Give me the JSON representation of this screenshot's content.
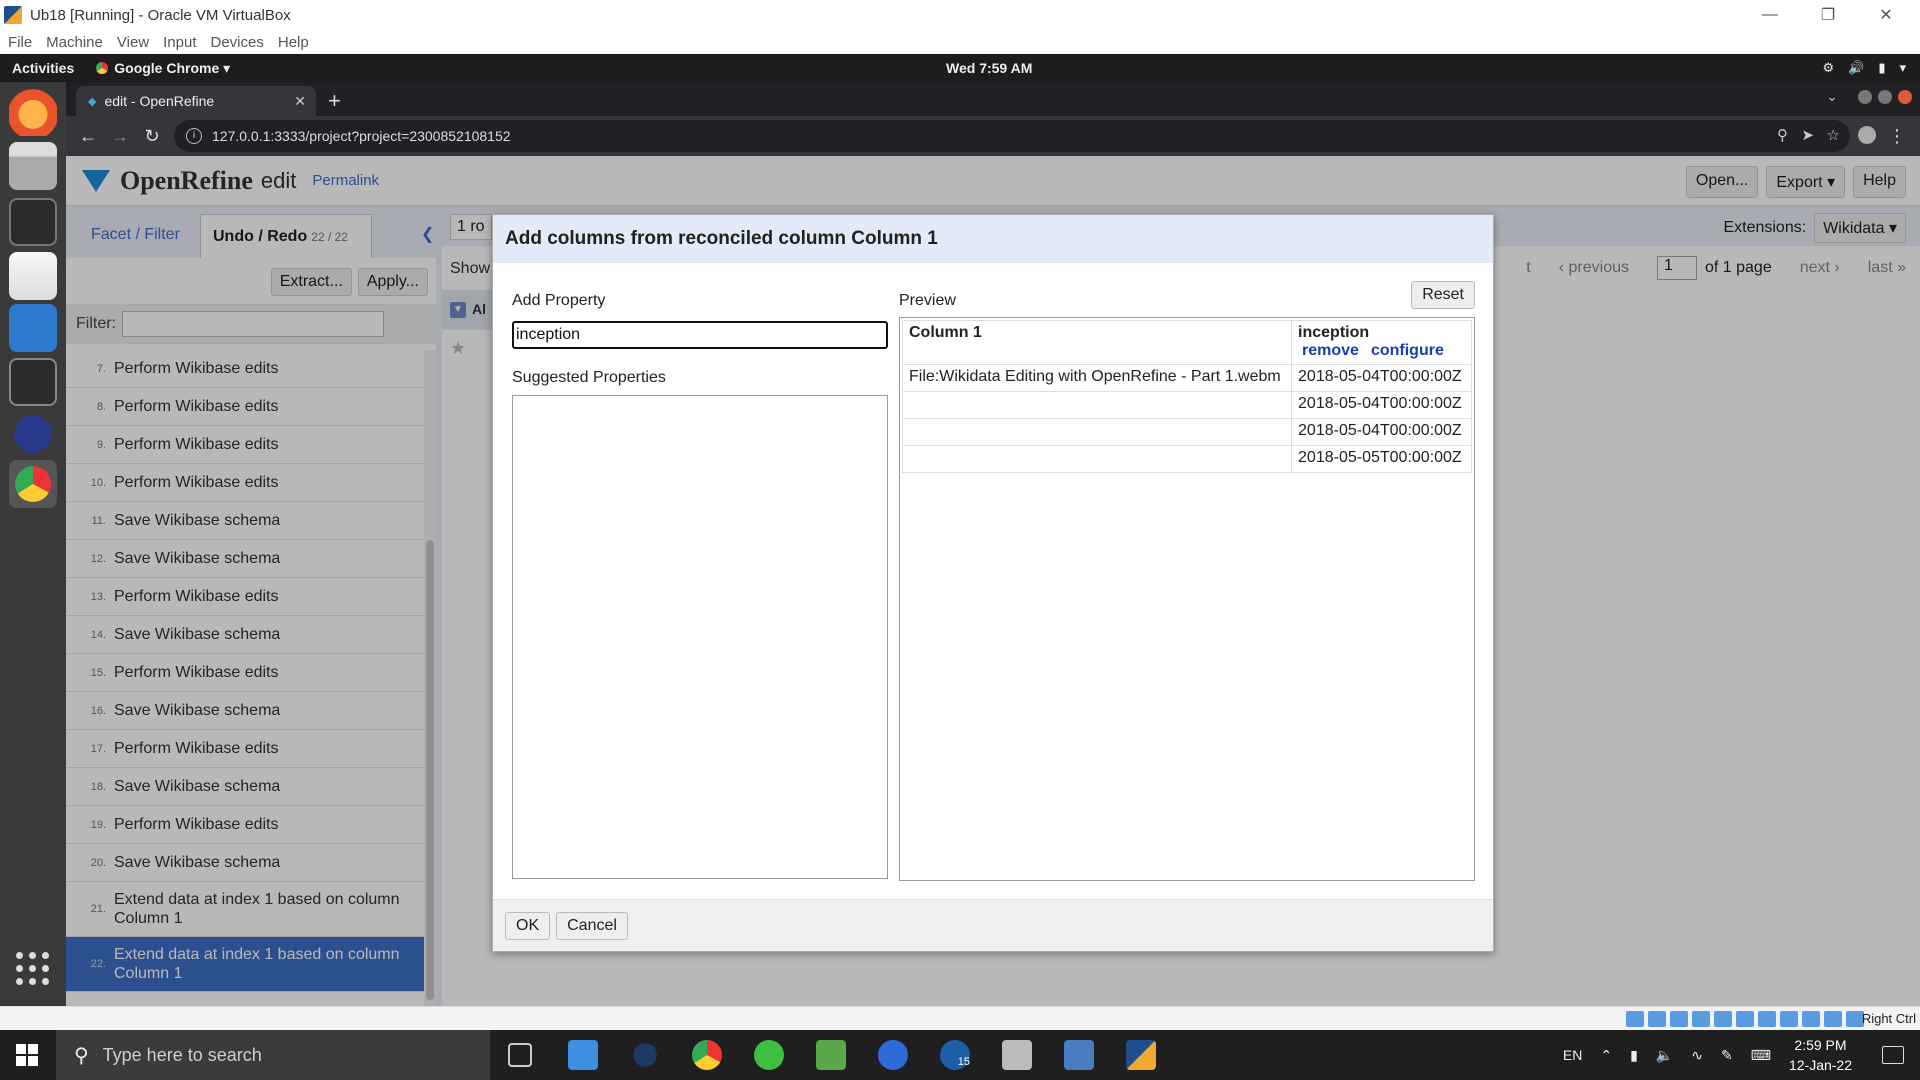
{
  "vbox": {
    "title": "Ub18 [Running] - Oracle VM VirtualBox",
    "menu": [
      "File",
      "Machine",
      "View",
      "Input",
      "Devices",
      "Help"
    ],
    "status_right": "Right Ctrl"
  },
  "gnome": {
    "activities": "Activities",
    "app": "Google Chrome ▾",
    "clock": "Wed  7:59 AM"
  },
  "chrome": {
    "tab_title": "edit - OpenRefine",
    "url": "127.0.0.1:3333/project?project=2300852108152"
  },
  "openrefine": {
    "brand": "OpenRefine",
    "mode": "edit",
    "permalink": "Permalink",
    "header_buttons": [
      "Open...",
      "Export ▾",
      "Help"
    ],
    "left_tabs": {
      "facet": "Facet / Filter",
      "undo": "Undo / Redo",
      "undo_count": "22 / 22"
    },
    "left_actions": [
      "Extract...",
      "Apply..."
    ],
    "filter_label": "Filter:",
    "history": [
      {
        "n": "7.",
        "t": "Perform Wikibase edits"
      },
      {
        "n": "8.",
        "t": "Perform Wikibase edits"
      },
      {
        "n": "9.",
        "t": "Perform Wikibase edits"
      },
      {
        "n": "10.",
        "t": "Perform Wikibase edits"
      },
      {
        "n": "11.",
        "t": "Save Wikibase schema"
      },
      {
        "n": "12.",
        "t": "Save Wikibase schema"
      },
      {
        "n": "13.",
        "t": "Perform Wikibase edits"
      },
      {
        "n": "14.",
        "t": "Save Wikibase schema"
      },
      {
        "n": "15.",
        "t": "Perform Wikibase edits"
      },
      {
        "n": "16.",
        "t": "Save Wikibase schema"
      },
      {
        "n": "17.",
        "t": "Perform Wikibase edits"
      },
      {
        "n": "18.",
        "t": "Save Wikibase schema"
      },
      {
        "n": "19.",
        "t": "Perform Wikibase edits"
      },
      {
        "n": "20.",
        "t": "Save Wikibase schema"
      },
      {
        "n": "21.",
        "t": "Extend data at index 1 based on column Column 1"
      },
      {
        "n": "22.",
        "t": "Extend data at index 1 based on column Column 1"
      }
    ],
    "rows_partial": "1 ro",
    "show_partial": "Show",
    "all_partial": "Al",
    "extensions_label": "Extensions:",
    "extensions_btn": "Wikidata ▾",
    "pager": {
      "first_partial": "t",
      "previous": "‹ previous",
      "page_value": "1",
      "of_pages": "of 1 page",
      "next": "next ›",
      "last": "last »"
    }
  },
  "dialog": {
    "title": "Add columns from reconciled column Column 1",
    "add_property_label": "Add Property",
    "property_input": "inception",
    "suggested_label": "Suggested Properties",
    "preview_label": "Preview",
    "reset": "Reset",
    "table": {
      "col1": "Column 1",
      "col2": "inception",
      "remove": "remove",
      "configure": "configure",
      "rows": [
        [
          "File:Wikidata Editing with OpenRefine - Part 1.webm",
          "2018-05-04T00:00:00Z"
        ],
        [
          "",
          "2018-05-04T00:00:00Z"
        ],
        [
          "",
          "2018-05-04T00:00:00Z"
        ],
        [
          "",
          "2018-05-05T00:00:00Z"
        ]
      ]
    },
    "ok": "OK",
    "cancel": "Cancel"
  },
  "taskbar": {
    "search_placeholder": "Type here to search",
    "lang": "EN",
    "time": "2:59 PM",
    "date": "12-Jan-22",
    "badge": "15"
  }
}
